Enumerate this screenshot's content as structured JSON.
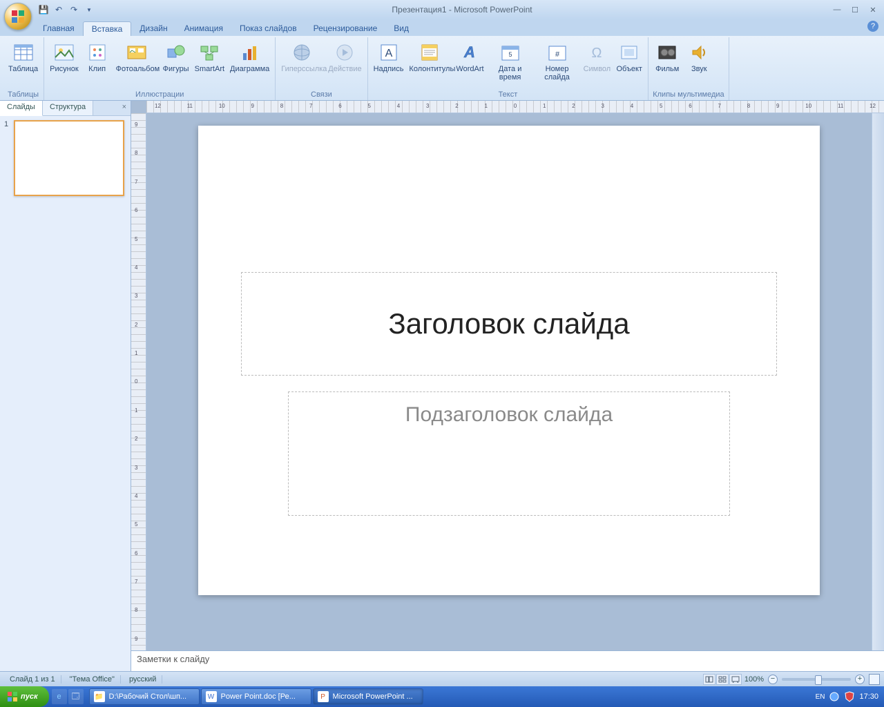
{
  "title": "Презентация1 - Microsoft PowerPoint",
  "qat": {
    "save": "save",
    "undo": "undo",
    "redo": "redo"
  },
  "tabs": [
    "Главная",
    "Вставка",
    "Дизайн",
    "Анимация",
    "Показ слайдов",
    "Рецензирование",
    "Вид"
  ],
  "activeTabIndex": 1,
  "ribbon": {
    "groups": [
      {
        "label": "Таблицы",
        "items": [
          {
            "label": "Таблица",
            "icon": "table"
          }
        ]
      },
      {
        "label": "Иллюстрации",
        "items": [
          {
            "label": "Рисунок",
            "icon": "picture"
          },
          {
            "label": "Клип",
            "icon": "clip"
          },
          {
            "label": "Фотоальбом",
            "icon": "photoalbum"
          },
          {
            "label": "Фигуры",
            "icon": "shapes"
          },
          {
            "label": "SmartArt",
            "icon": "smartart"
          },
          {
            "label": "Диаграмма",
            "icon": "chart"
          }
        ]
      },
      {
        "label": "Связи",
        "items": [
          {
            "label": "Гиперссылка",
            "icon": "hyperlink",
            "disabled": true
          },
          {
            "label": "Действие",
            "icon": "action",
            "disabled": true
          }
        ]
      },
      {
        "label": "Текст",
        "items": [
          {
            "label": "Надпись",
            "icon": "textbox"
          },
          {
            "label": "Колонтитулы",
            "icon": "headerfooter"
          },
          {
            "label": "WordArt",
            "icon": "wordart"
          },
          {
            "label": "Дата и время",
            "icon": "datetime"
          },
          {
            "label": "Номер слайда",
            "icon": "slidenum"
          },
          {
            "label": "Символ",
            "icon": "symbol",
            "disabled": true
          },
          {
            "label": "Объект",
            "icon": "object"
          }
        ]
      },
      {
        "label": "Клипы мультимедиа",
        "items": [
          {
            "label": "Фильм",
            "icon": "movie"
          },
          {
            "label": "Звук",
            "icon": "sound"
          }
        ]
      }
    ]
  },
  "leftPanel": {
    "tabs": [
      "Слайды",
      "Структура"
    ],
    "activeIndex": 0,
    "slideNum": "1"
  },
  "slide": {
    "titlePlaceholder": "Заголовок слайда",
    "subtitlePlaceholder": "Подзаголовок слайда"
  },
  "notes": "Заметки к слайду",
  "status": {
    "slideInfo": "Слайд 1 из 1",
    "theme": "\"Тема Office\"",
    "lang": "русский",
    "zoom": "100%"
  },
  "rulerH": [
    "12",
    "11",
    "10",
    "9",
    "8",
    "7",
    "6",
    "5",
    "4",
    "3",
    "2",
    "1",
    "0",
    "1",
    "2",
    "3",
    "4",
    "5",
    "6",
    "7",
    "8",
    "9",
    "10",
    "11",
    "12"
  ],
  "rulerV": [
    "9",
    "8",
    "7",
    "6",
    "5",
    "4",
    "3",
    "2",
    "1",
    "0",
    "1",
    "2",
    "3",
    "4",
    "5",
    "6",
    "7",
    "8",
    "9"
  ],
  "taskbar": {
    "start": "пуск",
    "tasks": [
      {
        "label": "D:\\Рабочий Стол\\шп...",
        "icon": "📁",
        "color": "#f3c25b"
      },
      {
        "label": "Power Point.doc [Ре...",
        "icon": "W",
        "color": "#3a6fd0"
      },
      {
        "label": "Microsoft PowerPoint ...",
        "icon": "P",
        "color": "#d05a2a",
        "active": true
      }
    ],
    "lang": "EN",
    "clock": "17:30"
  }
}
